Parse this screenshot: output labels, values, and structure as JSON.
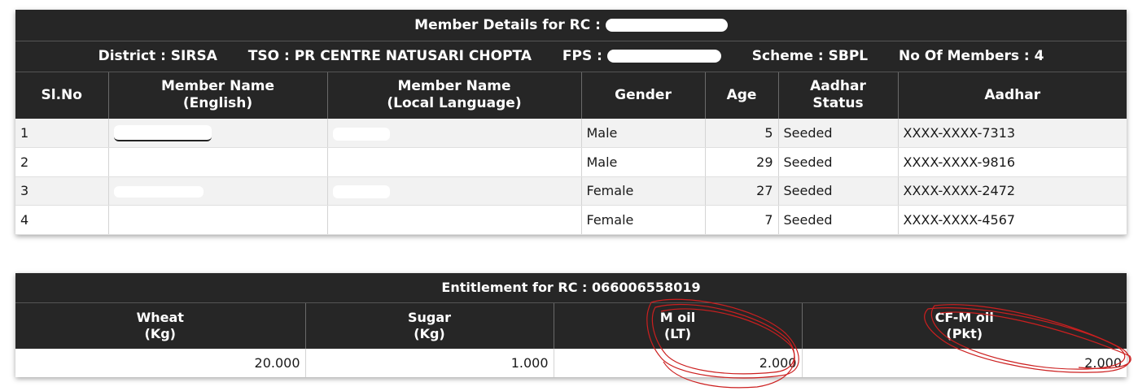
{
  "member_table": {
    "title": "Member Details for RC :",
    "info": {
      "district": "District : SIRSA",
      "tso": "TSO : PR CENTRE NATUSARI CHOPTA",
      "fps": "FPS :",
      "scheme": "Scheme : SBPL",
      "members": "No Of Members : 4"
    },
    "headers": {
      "slno": "Sl.No",
      "name_en_1": "Member Name",
      "name_en_2": "(English)",
      "name_local_1": "Member Name",
      "name_local_2": "(Local Language)",
      "gender": "Gender",
      "age": "Age",
      "aadhar_status_1": "Aadhar",
      "aadhar_status_2": "Status",
      "aadhar": "Aadhar"
    },
    "rows": [
      {
        "sl": "1",
        "gender": "Male",
        "age": "5",
        "status": "Seeded",
        "aadhar": "XXXX-XXXX-7313"
      },
      {
        "sl": "2",
        "gender": "Male",
        "age": "29",
        "status": "Seeded",
        "aadhar": "XXXX-XXXX-9816"
      },
      {
        "sl": "3",
        "gender": "Female",
        "age": "27",
        "status": "Seeded",
        "aadhar": "XXXX-XXXX-2472"
      },
      {
        "sl": "4",
        "gender": "Female",
        "age": "7",
        "status": "Seeded",
        "aadhar": "XXXX-XXXX-4567"
      }
    ]
  },
  "entitlement_table": {
    "title": "Entitlement for RC : 066006558019",
    "headers": [
      {
        "name": "Wheat",
        "unit": "(Kg)"
      },
      {
        "name": "Sugar",
        "unit": "(Kg)"
      },
      {
        "name": "M oil",
        "unit": "(LT)"
      },
      {
        "name": "CF-M oil",
        "unit": "(Pkt)"
      }
    ],
    "values": [
      "20.000",
      "1.000",
      "2.000",
      "2.000"
    ]
  },
  "colors": {
    "header_bg": "#262626",
    "header_text": "#ffffff",
    "odd_row_bg": "#f2f2f2",
    "annotation_red": "#cc1f1f"
  }
}
